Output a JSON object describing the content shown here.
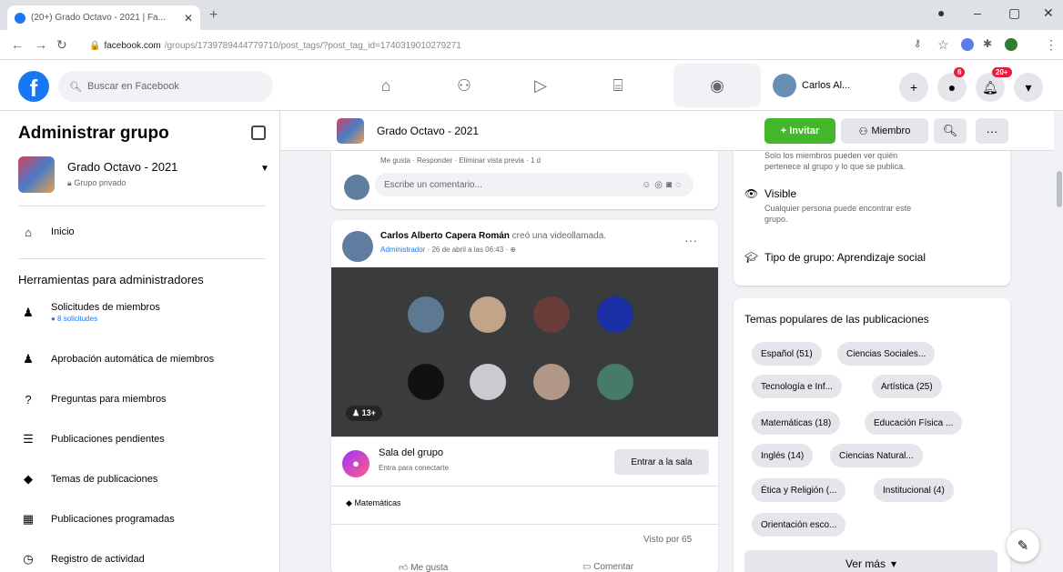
{
  "browser": {
    "tab_title": "(20+) Grado Octavo - 2021 | Fa...",
    "tab_close": "✕",
    "new_tab": "+",
    "url_host": "facebook.com",
    "url_path": "/groups/1739789444779710/post_tags/?post_tag_id=1740319010279271"
  },
  "fb": {
    "logo": "f",
    "search_placeholder": "Buscar en Facebook",
    "profile_name": "Carlos Al...",
    "messenger_badge": "6",
    "notifications_badge": "20+"
  },
  "sidebar": {
    "title": "Administrar grupo",
    "group_name": "Grado Octavo - 2021",
    "group_privacy": "Grupo privado",
    "home": "Inicio",
    "admin_tools_heading": "Herramientas para administradores",
    "items": [
      {
        "label": "Solicitudes de miembros",
        "sub": "● 8 solicitudes"
      },
      {
        "label": "Aprobación automática de miembros",
        "sub": ""
      },
      {
        "label": "Preguntas para miembros",
        "sub": ""
      },
      {
        "label": "Publicaciones pendientes",
        "sub": ""
      },
      {
        "label": "Temas de publicaciones",
        "sub": ""
      },
      {
        "label": "Publicaciones programadas",
        "sub": ""
      },
      {
        "label": "Registro de actividad",
        "sub": ""
      }
    ]
  },
  "group_header": {
    "name": "Grado Octavo - 2021",
    "invite": "+ Invitar",
    "member": "Miembro"
  },
  "feed": {
    "comment_actions": "Me gusta · Responder · Eliminar vista previa · 1 d",
    "comment_placeholder": "Escribe un comentario...",
    "post_author": "Carlos Alberto Capera Román",
    "post_action": "creó una videollamada.",
    "post_role": "Administrador",
    "post_time": "· 26 de abril a las 06:43 · ⊕",
    "participants_count": "13+",
    "room_title": "Sala del grupo",
    "room_sub": "Entra para conectarte",
    "room_button": "Entrar a la sala",
    "tag": "Matemáticas",
    "views": "Visto por 65",
    "like": "Me gusta",
    "comment": "Comentar"
  },
  "about": {
    "privacy_note_1": "Solo los miembros pueden ver quién",
    "privacy_note_2": "pertenece al grupo y lo que se publica.",
    "visible_title": "Visible",
    "visible_desc_1": "Cualquier persona puede encontrar este",
    "visible_desc_2": "grupo.",
    "group_type": "Tipo de grupo: Aprendizaje social"
  },
  "topics": {
    "heading": "Temas populares de las publicaciones",
    "pills": [
      "Español (51)",
      "Ciencias Sociales...",
      "Tecnología e Inf...",
      "Artística (25)",
      "Matemáticas (18)",
      "Educación Física ...",
      "Inglés (14)",
      "Ciencias Natural...",
      "Ética y Religión (...",
      "Institucional (4)",
      "Orientación esco..."
    ],
    "see_more": "Ver más"
  }
}
